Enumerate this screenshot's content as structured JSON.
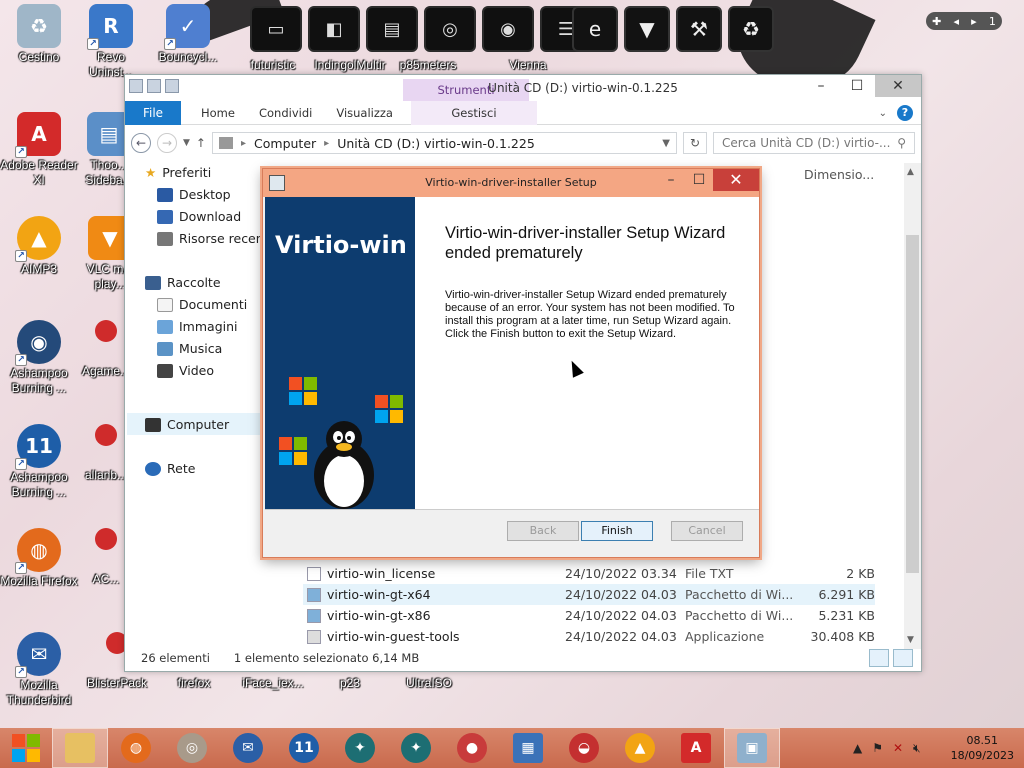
{
  "desktop": {
    "icons": [
      {
        "label": "Cestino"
      },
      {
        "label": "Revo Uninst..."
      },
      {
        "label": "Bouncycl..."
      },
      {
        "label": "Adobe Reader XI"
      },
      {
        "label": "Thoo... Sideba..."
      },
      {
        "label": "AIMP3"
      },
      {
        "label": "VLC m... play..."
      },
      {
        "label": "Ashampoo Burning ..."
      },
      {
        "label": "Agame..."
      },
      {
        "label": "Ashampoo Burning ..."
      },
      {
        "label": "allanb..."
      },
      {
        "label": "Mozilla Firefox"
      },
      {
        "label": "AC..."
      },
      {
        "label": "Mozilla Thunderbird"
      },
      {
        "label": "BlisterPack"
      },
      {
        "label": "firefox"
      },
      {
        "label": "iFace_iex..."
      },
      {
        "label": "p23"
      },
      {
        "label": "UltraISO"
      }
    ],
    "dock_labels": [
      "futuristic",
      "IndingolMultir",
      "p85meters",
      "Vienna"
    ],
    "pager": {
      "page": "1"
    }
  },
  "explorer": {
    "title": "Unità CD (D:) virtio-win-0.1.225",
    "contextual_tab": "Strumenti applicazioni",
    "tabs": [
      "File",
      "Home",
      "Condividi",
      "Visualizza",
      "Gestisci"
    ],
    "address": {
      "root": "Computer",
      "drive": "Unità CD (D:) virtio-win-0.1.225"
    },
    "search_placeholder": "Cerca Unità CD (D:) virtio-...",
    "nav": {
      "preferiti": "Preferiti",
      "desktop": "Desktop",
      "download": "Download",
      "recenti": "Risorse recenti",
      "raccolte": "Raccolte",
      "documenti": "Documenti",
      "immagini": "Immagini",
      "musica": "Musica",
      "video": "Video",
      "computer": "Computer",
      "rete": "Rete"
    },
    "column_size": "Dimensio...",
    "files": [
      {
        "name": "virtio-win_license",
        "date": "24/10/2022 03.34",
        "type": "File TXT",
        "size": "2 KB"
      },
      {
        "name": "virtio-win-gt-x64",
        "date": "24/10/2022 04.03",
        "type": "Pacchetto di Wi...",
        "size": "6.291 KB"
      },
      {
        "name": "virtio-win-gt-x86",
        "date": "24/10/2022 04.03",
        "type": "Pacchetto di Wi...",
        "size": "5.231 KB"
      },
      {
        "name": "virtio-win-guest-tools",
        "date": "24/10/2022 04.03",
        "type": "Applicazione",
        "size": "30.408 KB"
      }
    ],
    "status": {
      "count": "26 elementi",
      "selection": "1 elemento selezionato  6,14 MB"
    }
  },
  "dialog": {
    "title": "Virtio-win-driver-installer Setup",
    "brand": "Virtio-win",
    "heading": "Virtio-win-driver-installer Setup Wizard ended prematurely",
    "body": "Virtio-win-driver-installer Setup Wizard ended prematurely because of an error. Your system has not been modified. To install this program at a later time, run Setup Wizard again. Click the Finish button to exit the Setup Wizard.",
    "buttons": {
      "back": "Back",
      "finish": "Finish",
      "cancel": "Cancel"
    }
  },
  "taskbar": {
    "time": "08.51",
    "date": "18/09/2023"
  },
  "colors": {
    "accent": "#1979ca",
    "dialog_title": "#f4a683",
    "banner": "#0d3c6f",
    "taskbar": "#c96a4d"
  }
}
